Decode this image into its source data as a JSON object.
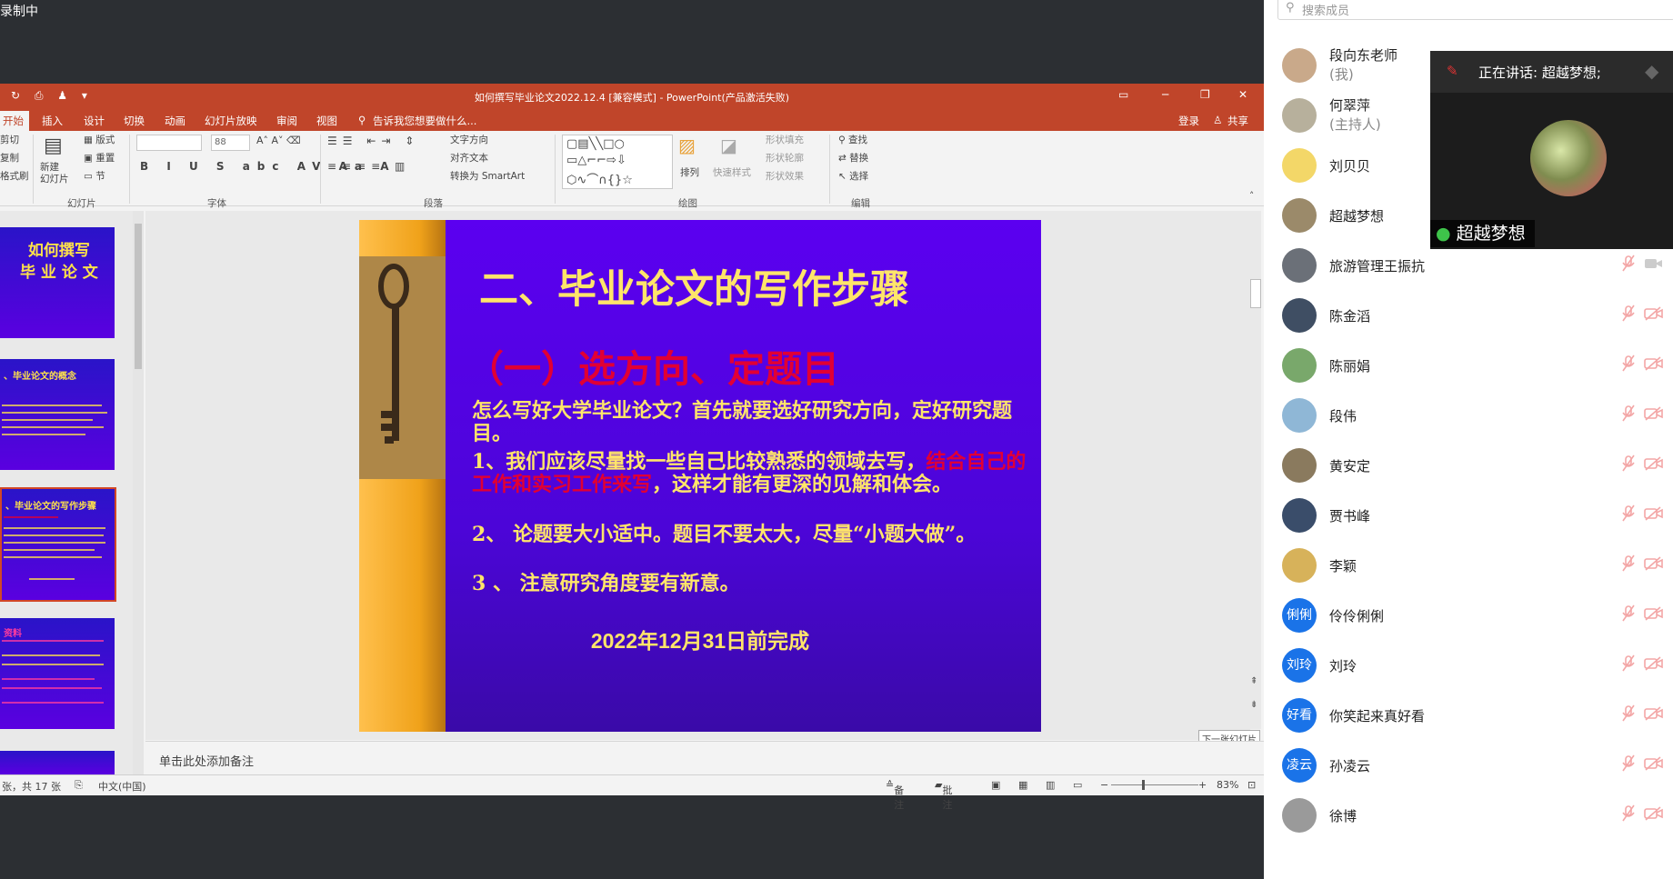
{
  "recording_status": "录制中",
  "ppt": {
    "window_title": "如何撰写毕业论文2022.12.4 [兼容模式] - PowerPoint(产品激活失败)",
    "tabs": [
      "开始",
      "插入",
      "设计",
      "切换",
      "动画",
      "幻灯片放映",
      "审阅",
      "视图"
    ],
    "tell_me": "告诉我您想要做什么...",
    "login": "登录",
    "share": "共享",
    "ribbon": {
      "clipboard": {
        "cut": "剪切",
        "copy": "复制",
        "format_painter": "格式刷"
      },
      "slides": {
        "new_slide": "新建\n幻灯片",
        "layout": "版式",
        "reset": "重置",
        "section": "节",
        "group": "幻灯片"
      },
      "font": {
        "size": "88",
        "group": "字体"
      },
      "paragraph": {
        "text_direction": "文字方向",
        "align_text": "对齐文本",
        "smartart": "转换为 SmartArt",
        "group": "段落"
      },
      "drawing": {
        "arrange": "排列",
        "quick_styles": "快速样式",
        "shape_fill": "形状填充",
        "shape_outline": "形状轮廓",
        "shape_effects": "形状效果",
        "group": "绘图"
      },
      "editing": {
        "find": "查找",
        "replace": "替换",
        "select": "选择",
        "group": "编辑"
      }
    },
    "thumbnails": [
      {
        "title": "如何撰写\n毕 业 论 文"
      },
      {
        "title": "、毕业论文的概念"
      },
      {
        "title": "、毕业论文的写作步骤"
      },
      {
        "title": "资料"
      }
    ],
    "slide": {
      "title": "二、毕业论文的写作步骤",
      "subtitle": "（一）选方向、定题目",
      "p1": "怎么写好大学毕业论文？首先就要选好研究方向，定好研究题目。",
      "p2a": "1、我们应该尽量找一些自己比较熟悉的领域去写，",
      "p2b": "结合自己的工作和实习工作来写",
      "p2c": "，这样才能有更深的见解和体会。",
      "p3": "2、 论题要大小适中。题目不要太大，尽量“小题大做”。",
      "p4": "3 、 注意研究角度要有新意。",
      "deadline": "2022年12月31日前完成"
    },
    "notes_placeholder": "单击此处添加备注",
    "tooltip": "下一张幻灯片",
    "status": {
      "slide_count": "张，共 17 张",
      "language": "中文(中国)",
      "notes": "备注",
      "comments": "批注",
      "zoom": "83%"
    }
  },
  "members_panel": {
    "search_placeholder": "搜索成员",
    "speaker": {
      "label": "正在讲话: 超越梦想;",
      "name": "超越梦想"
    },
    "members": [
      {
        "name": "段向东老师",
        "role": "(我)",
        "avatar_color": "#c9a98a"
      },
      {
        "name": "何翠萍",
        "role": "(主持人)",
        "avatar_color": "#b7b09c"
      },
      {
        "name": "刘贝贝",
        "avatar_color": "#f3d768"
      },
      {
        "name": "超越梦想",
        "avatar_color": "#9b8a6a"
      },
      {
        "name": "旅游管理王振抗",
        "avatar_color": "#6b7078"
      },
      {
        "name": "陈金滔",
        "avatar_color": "#3f4e63"
      },
      {
        "name": "陈丽娟",
        "avatar_color": "#79a86b"
      },
      {
        "name": "段伟",
        "avatar_color": "#8fb7d6"
      },
      {
        "name": "黄安定",
        "avatar_color": "#8a7a5e"
      },
      {
        "name": "贾书峰",
        "avatar_color": "#3a4d6a"
      },
      {
        "name": "李颖",
        "avatar_color": "#d7b25a"
      },
      {
        "name": "伶伶俐俐",
        "avatar_text": "俐俐",
        "avatar_color": "#1a73e8"
      },
      {
        "name": "刘玲",
        "avatar_text": "刘玲",
        "avatar_color": "#1a73e8"
      },
      {
        "name": "你笑起来真好看",
        "avatar_text": "好看",
        "avatar_color": "#1a73e8"
      },
      {
        "name": "孙凌云",
        "avatar_text": "凌云",
        "avatar_color": "#1a73e8"
      },
      {
        "name": "徐博",
        "avatar_color": "#9a9a9a"
      }
    ]
  }
}
